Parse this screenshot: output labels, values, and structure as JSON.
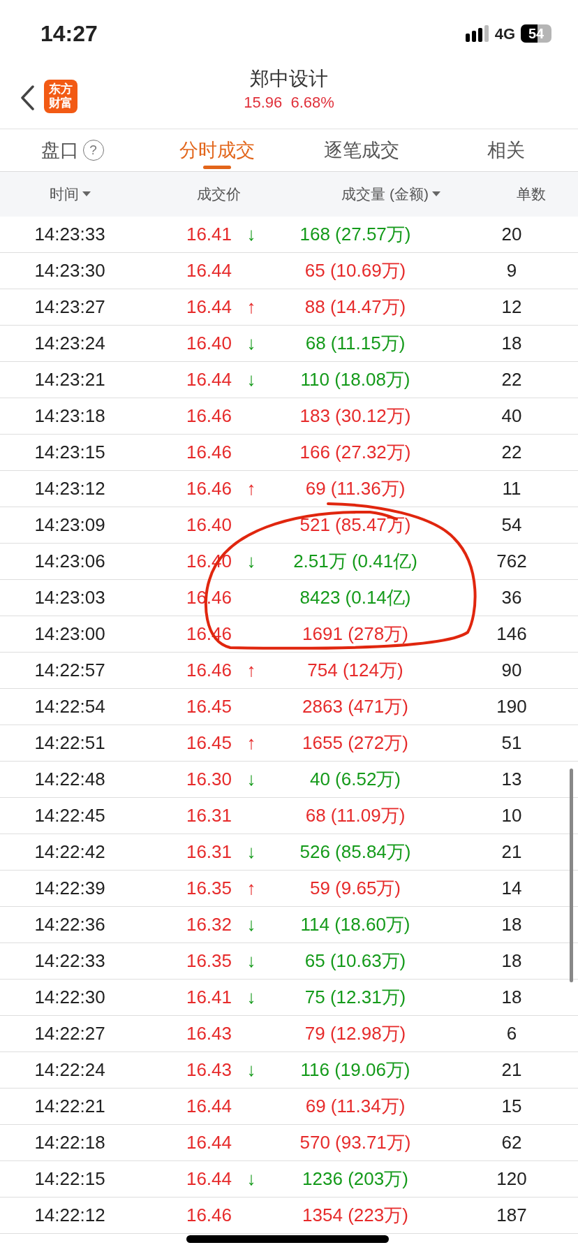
{
  "status_bar": {
    "time": "14:27",
    "network": "4G",
    "battery": "54"
  },
  "header": {
    "logo": "东方财富",
    "title": "郑中设计",
    "price": "15.96",
    "change": "6.68%"
  },
  "tabs": [
    {
      "label": "盘口",
      "help": "?",
      "selected": false
    },
    {
      "label": "分时成交",
      "selected": true
    },
    {
      "label": "逐笔成交",
      "selected": false
    },
    {
      "label": "相关",
      "selected": false
    }
  ],
  "table": {
    "columns": [
      {
        "label": "时间",
        "sortable": true
      },
      {
        "label": "成交价",
        "sortable": false
      },
      {
        "label": "成交量 (金额)",
        "sortable": true
      },
      {
        "label": "单数",
        "sortable": false
      }
    ],
    "rows": [
      {
        "time": "14:23:33",
        "price": "16.41",
        "arrow": "↓",
        "color": "#149a1a",
        "volume": "168 (27.57万)",
        "count": "20"
      },
      {
        "time": "14:23:30",
        "price": "16.44",
        "color": "#e62b2b",
        "volume": "65 (10.69万)",
        "count": "9"
      },
      {
        "time": "14:23:27",
        "price": "16.44",
        "arrow": "↑",
        "color": "#e62b2b",
        "volume": "88 (14.47万)",
        "count": "12"
      },
      {
        "time": "14:23:24",
        "price": "16.40",
        "arrow": "↓",
        "color": "#149a1a",
        "volume": "68 (11.15万)",
        "count": "18"
      },
      {
        "time": "14:23:21",
        "price": "16.44",
        "arrow": "↓",
        "color": "#149a1a",
        "volume": "110 (18.08万)",
        "count": "22"
      },
      {
        "time": "14:23:18",
        "price": "16.46",
        "color": "#e62b2b",
        "volume": "183 (30.12万)",
        "count": "40"
      },
      {
        "time": "14:23:15",
        "price": "16.46",
        "color": "#e62b2b",
        "volume": "166 (27.32万)",
        "count": "22"
      },
      {
        "time": "14:23:12",
        "price": "16.46",
        "arrow": "↑",
        "color": "#e62b2b",
        "volume": "69 (11.36万)",
        "count": "11"
      },
      {
        "time": "14:23:09",
        "price": "16.40",
        "color": "#e62b2b",
        "volume": "521 (85.47万)",
        "count": "54"
      },
      {
        "time": "14:23:06",
        "price": "16.40",
        "arrow": "↓",
        "color": "#149a1a",
        "volume": "2.51万 (0.41亿)",
        "count": "762"
      },
      {
        "time": "14:23:03",
        "price": "16.46",
        "color": "#149a1a",
        "volume": "8423 (0.14亿)",
        "count": "36"
      },
      {
        "time": "14:23:00",
        "price": "16.46",
        "color": "#e62b2b",
        "volume": "1691 (278万)",
        "count": "146"
      },
      {
        "time": "14:22:57",
        "price": "16.46",
        "arrow": "↑",
        "color": "#e62b2b",
        "volume": "754 (124万)",
        "count": "90"
      },
      {
        "time": "14:22:54",
        "price": "16.45",
        "color": "#e62b2b",
        "volume": "2863 (471万)",
        "count": "190"
      },
      {
        "time": "14:22:51",
        "price": "16.45",
        "arrow": "↑",
        "color": "#e62b2b",
        "volume": "1655 (272万)",
        "count": "51"
      },
      {
        "time": "14:22:48",
        "price": "16.30",
        "arrow": "↓",
        "color": "#149a1a",
        "volume": "40 (6.52万)",
        "count": "13"
      },
      {
        "time": "14:22:45",
        "price": "16.31",
        "color": "#e62b2b",
        "volume": "68 (11.09万)",
        "count": "10"
      },
      {
        "time": "14:22:42",
        "price": "16.31",
        "arrow": "↓",
        "color": "#149a1a",
        "volume": "526 (85.84万)",
        "count": "21"
      },
      {
        "time": "14:22:39",
        "price": "16.35",
        "arrow": "↑",
        "color": "#e62b2b",
        "volume": "59 (9.65万)",
        "count": "14"
      },
      {
        "time": "14:22:36",
        "price": "16.32",
        "arrow": "↓",
        "color": "#149a1a",
        "volume": "114 (18.60万)",
        "count": "18"
      },
      {
        "time": "14:22:33",
        "price": "16.35",
        "arrow": "↓",
        "color": "#149a1a",
        "volume": "65 (10.63万)",
        "count": "18"
      },
      {
        "time": "14:22:30",
        "price": "16.41",
        "arrow": "↓",
        "color": "#149a1a",
        "volume": "75 (12.31万)",
        "count": "18"
      },
      {
        "time": "14:22:27",
        "price": "16.43",
        "color": "#e62b2b",
        "volume": "79 (12.98万)",
        "count": "6"
      },
      {
        "time": "14:22:24",
        "price": "16.43",
        "arrow": "↓",
        "color": "#149a1a",
        "volume": "116 (19.06万)",
        "count": "21"
      },
      {
        "time": "14:22:21",
        "price": "16.44",
        "color": "#e62b2b",
        "volume": "69 (11.34万)",
        "count": "15"
      },
      {
        "time": "14:22:18",
        "price": "16.44",
        "color": "#e62b2b",
        "volume": "570 (93.71万)",
        "count": "62"
      },
      {
        "time": "14:22:15",
        "price": "16.44",
        "arrow": "↓",
        "color": "#149a1a",
        "volume": "1236 (203万)",
        "count": "120"
      },
      {
        "time": "14:22:12",
        "price": "16.46",
        "color": "#e62b2b",
        "volume": "1354 (223万)",
        "count": "187"
      }
    ]
  }
}
